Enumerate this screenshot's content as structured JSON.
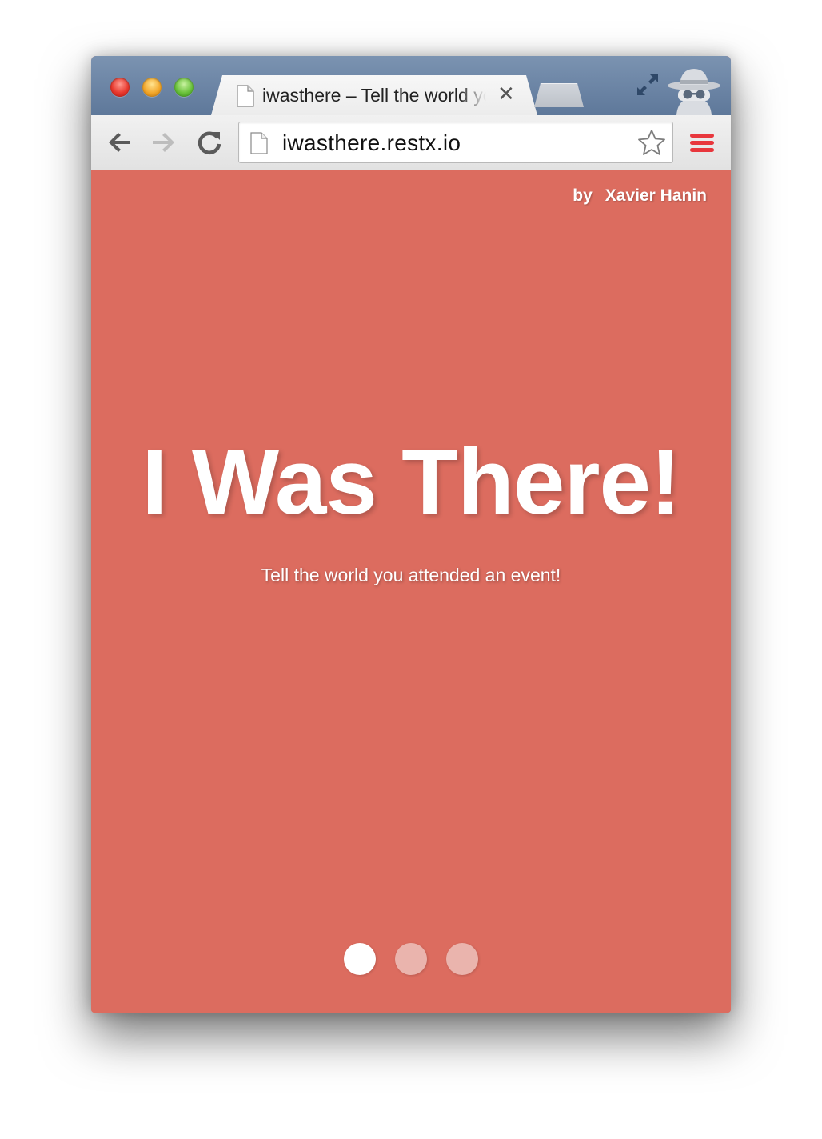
{
  "browser": {
    "tab": {
      "title": "iwasthere – Tell the world you attended an event!",
      "close_glyph": "✕"
    },
    "address_bar": {
      "url": "iwasthere.restx.io"
    },
    "icons": {
      "traffic_lights": [
        "close-icon",
        "minimize-icon",
        "zoom-icon"
      ],
      "nav": [
        "back-arrow-icon",
        "forward-arrow-icon",
        "reload-icon"
      ],
      "other": [
        "page-icon",
        "bookmark-star-icon",
        "menu-icon",
        "fullscreen-icon",
        "incognito-icon"
      ]
    }
  },
  "page": {
    "byline": {
      "prefix": "by",
      "author": "Xavier Hanin"
    },
    "title": "I Was There!",
    "subtitle": "Tell the world you attended an event!",
    "background_color": "#dc6c5f",
    "carousel": {
      "count": 3,
      "active_index": 0
    }
  }
}
